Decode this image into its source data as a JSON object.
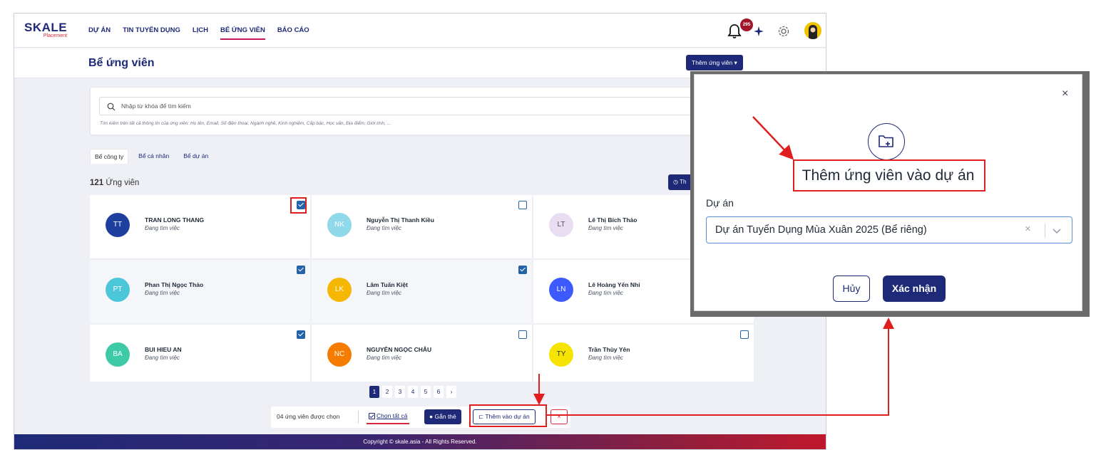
{
  "brand": {
    "logo_main": "SKALE",
    "logo_sub": "Placement"
  },
  "nav": {
    "items": [
      "DỰ ÁN",
      "TIN TUYỂN DỤNG",
      "LỊCH",
      "BỂ ỨNG VIÊN",
      "BÁO CÁO"
    ],
    "active": "BỂ ỨNG VIÊN"
  },
  "notifications": {
    "count": "295"
  },
  "page": {
    "title": "Bể ứng viên",
    "add_button": "Thêm ứng viên ▾"
  },
  "search": {
    "placeholder": "Nhập từ khóa để tìm kiếm",
    "hint": "Tìm kiếm trên tất cả thông tin của ứng viên: Họ tên, Email, Số điện thoại, Ngành nghề, Kinh nghiệm, Cấp bậc, Học vấn, Địa điểm, Giới tính, ..."
  },
  "tabs": [
    "Bể công ty",
    "Bể cá nhân",
    "Bể dự án"
  ],
  "count": {
    "number": "121",
    "label": "Ứng viên"
  },
  "history_button": "Th",
  "candidates": [
    {
      "initials": "TT",
      "name": "TRAN LONG THANG",
      "status": "Đang tìm việc",
      "color": "#1e3f9e",
      "checked": true
    },
    {
      "initials": "NK",
      "name": "Nguyễn Thị Thanh Kiều",
      "status": "Đang tìm việc",
      "color": "#8fd9ea",
      "checked": false
    },
    {
      "initials": "LT",
      "name": "Lê Thị Bích Thảo",
      "status": "Đang tìm việc",
      "color": "#e9ddf2",
      "checked": false
    },
    {
      "initials": "PT",
      "name": "Phan Thị Ngọc Thảo",
      "status": "Đang tìm việc",
      "color": "#4cc7d9",
      "checked": true
    },
    {
      "initials": "LK",
      "name": "Lâm Tuấn Kiệt",
      "status": "Đang tìm việc",
      "color": "#f5b700",
      "checked": true
    },
    {
      "initials": "LN",
      "name": "Lê Hoàng Yến Nhi",
      "status": "Đang tìm việc",
      "color": "#3d5afe",
      "checked": false
    },
    {
      "initials": "BA",
      "name": "BUI HIEU AN",
      "status": "Đang tìm việc",
      "color": "#3ec9a7",
      "checked": true
    },
    {
      "initials": "NC",
      "name": "NGUYỄN NGỌC CHÂU",
      "status": "Đang tìm việc",
      "color": "#f57c00",
      "checked": false
    },
    {
      "initials": "TY",
      "name": "Trần Thùy Yên",
      "status": "Đang tìm việc",
      "color": "#f6e300",
      "checked": false
    }
  ],
  "pagination": {
    "pages": [
      "1",
      "2",
      "3",
      "4",
      "5",
      "6",
      "›"
    ],
    "current": "1"
  },
  "actionbar": {
    "selected_text": "04 ứng viên được chọn",
    "select_all": "Chọn tất cả",
    "tag": "Gắn thẻ",
    "add_to_project": "Thêm vào dự án",
    "close": "×"
  },
  "footer": {
    "copyright": "Copyright © skale.asia - All Rights Reserved."
  },
  "modal": {
    "close": "×",
    "title": "Thêm ứng viên vào dự án",
    "field_label": "Dự án",
    "selected_value": "Dự án Tuyển Dụng Mùa Xuân 2025 (Bể riêng)",
    "clear": "×",
    "cancel": "Hủy",
    "confirm": "Xác nhận"
  },
  "colors": {
    "primary": "#1e2a78",
    "accent_red": "#e01e1e",
    "brand_red": "#d7263d"
  }
}
